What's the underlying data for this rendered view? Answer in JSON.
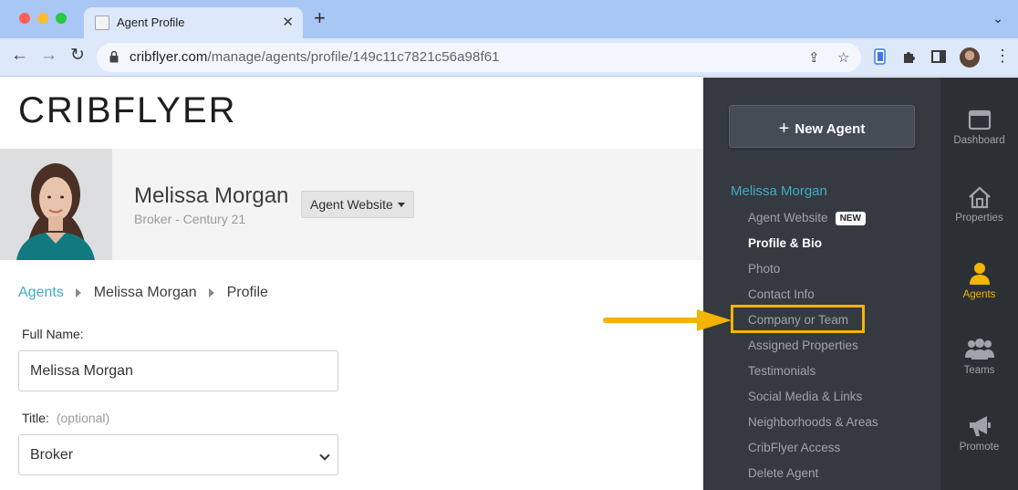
{
  "browser": {
    "tab_title": "Agent Profile",
    "url_host": "cribflyer.com",
    "url_path": "/manage/agents/profile/149c11c7821c56a98f61"
  },
  "header": {
    "logo": "CRIBFLYER"
  },
  "profile": {
    "name": "Melissa Morgan",
    "subtitle": "Broker - Century 21",
    "website_button": "Agent Website"
  },
  "breadcrumb": {
    "root": "Agents",
    "agent": "Melissa Morgan",
    "current": "Profile"
  },
  "form": {
    "full_name_label": "Full Name:",
    "full_name_value": "Melissa Morgan",
    "title_label": "Title:",
    "title_optional": "(optional)",
    "title_value": "Broker"
  },
  "sidebar": {
    "new_agent_label": "New Agent",
    "agent_heading": "Melissa Morgan",
    "new_badge": "NEW",
    "items": [
      {
        "label": "Agent Website"
      },
      {
        "label": "Profile & Bio"
      },
      {
        "label": "Photo"
      },
      {
        "label": "Contact Info"
      },
      {
        "label": "Company or Team"
      },
      {
        "label": "Assigned Properties"
      },
      {
        "label": "Testimonials"
      },
      {
        "label": "Social Media & Links"
      },
      {
        "label": "Neighborhoods & Areas"
      },
      {
        "label": "CribFlyer Access"
      },
      {
        "label": "Delete Agent"
      }
    ]
  },
  "rail": {
    "items": [
      {
        "label": "Dashboard",
        "icon": "browser-window-icon"
      },
      {
        "label": "Properties",
        "icon": "house-icon"
      },
      {
        "label": "Agents",
        "icon": "person-icon"
      },
      {
        "label": "Teams",
        "icon": "people-group-icon"
      },
      {
        "label": "Promote",
        "icon": "megaphone-icon"
      }
    ]
  },
  "colors": {
    "accent": "#3dadc7",
    "highlight": "#f4b400",
    "sidebar_bg": "#343a40",
    "rail_bg": "#2b3035"
  }
}
